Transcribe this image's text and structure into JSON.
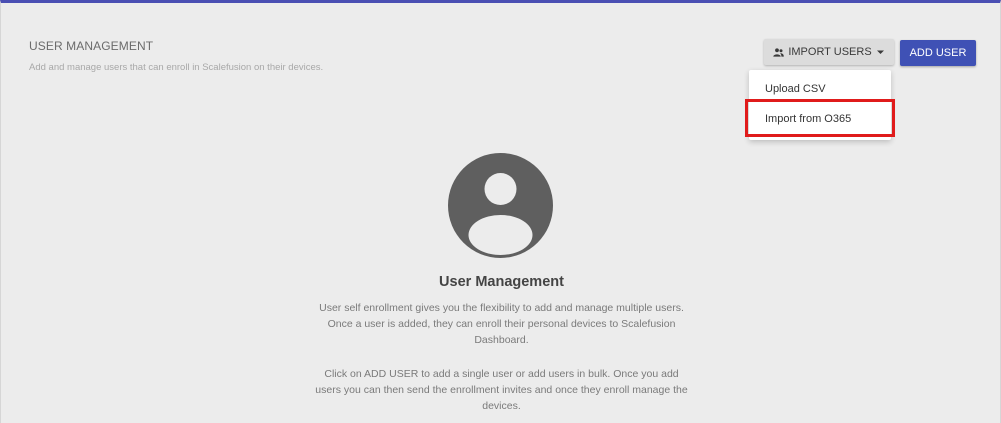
{
  "header": {
    "title": "USER MANAGEMENT",
    "subtitle": "Add and manage users that can enroll in Scalefusion on their devices."
  },
  "toolbar": {
    "import_label": "IMPORT USERS",
    "import_icon": "users-icon",
    "dropdown_icon": "caret-down-icon",
    "add_label": "ADD USER",
    "add_color": "#3f51b5"
  },
  "dropdown": {
    "items": [
      {
        "label": "Upload CSV"
      },
      {
        "label": "Import from O365"
      }
    ],
    "highlight_color": "#e01b1b"
  },
  "empty_state": {
    "icon": "user-avatar-icon",
    "title": "User Management",
    "paragraph_1": "User self enrollment gives you the flexibility to add and manage multiple users. Once a user is added, they can enroll their personal devices to Scalefusion Dashboard.",
    "paragraph_2": "Click on ADD USER to add a single user or add users in bulk. Once you add users you can then send the enrollment invites and once they enroll manage the devices."
  }
}
